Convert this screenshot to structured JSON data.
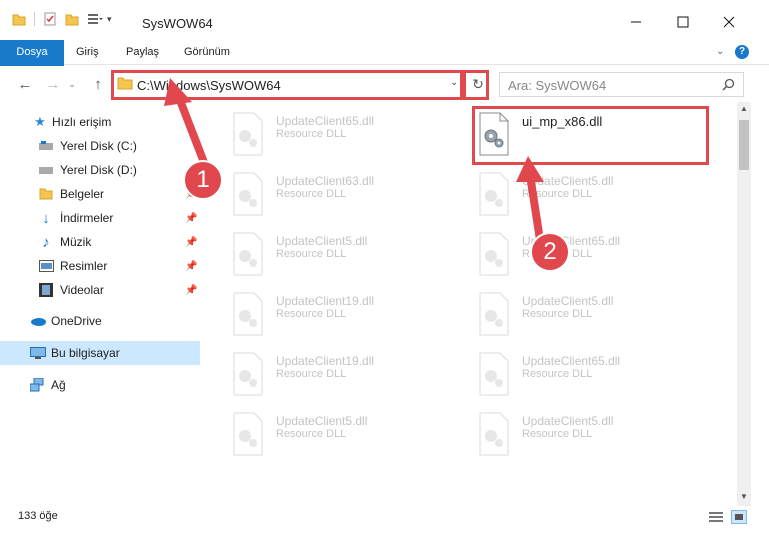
{
  "window": {
    "title": "SysWOW64",
    "minimize_icon": "minimize-icon",
    "maximize_icon": "maximize-icon",
    "close_icon": "close-icon"
  },
  "ribbon": {
    "tabs": [
      "Dosya",
      "Giriş",
      "Paylaş",
      "Görünüm"
    ]
  },
  "address": {
    "path": "C:\\Windows\\SysWOW64",
    "search_placeholder": "Ara: SysWOW64"
  },
  "sidebar": {
    "items": [
      {
        "label": "Hızlı erişim",
        "icon": "star-icon",
        "pinned": false
      },
      {
        "label": "Yerel Disk (C:)",
        "icon": "drive-icon",
        "pinned": false
      },
      {
        "label": "Yerel Disk (D:)",
        "icon": "drive-icon",
        "pinned": false
      },
      {
        "label": "Belgeler",
        "icon": "documents-icon",
        "pinned": true
      },
      {
        "label": "İndirmeler",
        "icon": "download-icon",
        "pinned": true
      },
      {
        "label": "Müzik",
        "icon": "music-icon",
        "pinned": true
      },
      {
        "label": "Resimler",
        "icon": "pictures-icon",
        "pinned": true
      },
      {
        "label": "Videolar",
        "icon": "videos-icon",
        "pinned": true
      },
      {
        "label": "OneDrive",
        "icon": "cloud-icon",
        "pinned": false
      },
      {
        "label": "Bu bilgisayar",
        "icon": "computer-icon",
        "pinned": false
      },
      {
        "label": "Ağ",
        "icon": "network-icon",
        "pinned": false
      }
    ]
  },
  "files": {
    "left_column": [
      {
        "name": "UpdateClient65.dll",
        "type": "Resource DLL"
      },
      {
        "name": "UpdateClient63.dll",
        "type": "Resource DLL"
      },
      {
        "name": "UpdateClient5.dll",
        "type": "Resource DLL"
      },
      {
        "name": "UpdateClient19.dll",
        "type": "Resource DLL"
      },
      {
        "name": "UpdateClient19.dll",
        "type": "Resource DLL"
      },
      {
        "name": "UpdateClient5.dll",
        "type": "Resource DLL"
      }
    ],
    "right_column": [
      {
        "name": "ui_mp_x86.dll",
        "type": ""
      },
      {
        "name": "UpdateClient5.dll",
        "type": "Resource DLL"
      },
      {
        "name": "UpdateClient65.dll",
        "type": "Resource DLL"
      },
      {
        "name": "UpdateClient5.dll",
        "type": "Resource DLL"
      },
      {
        "name": "UpdateClient65.dll",
        "type": "Resource DLL"
      },
      {
        "name": "UpdateClient5.dll",
        "type": "Resource DLL"
      }
    ]
  },
  "status": {
    "item_count": "133 öğe"
  },
  "annotations": {
    "badge1": "1",
    "badge2": "2",
    "color": "#e0484d"
  }
}
